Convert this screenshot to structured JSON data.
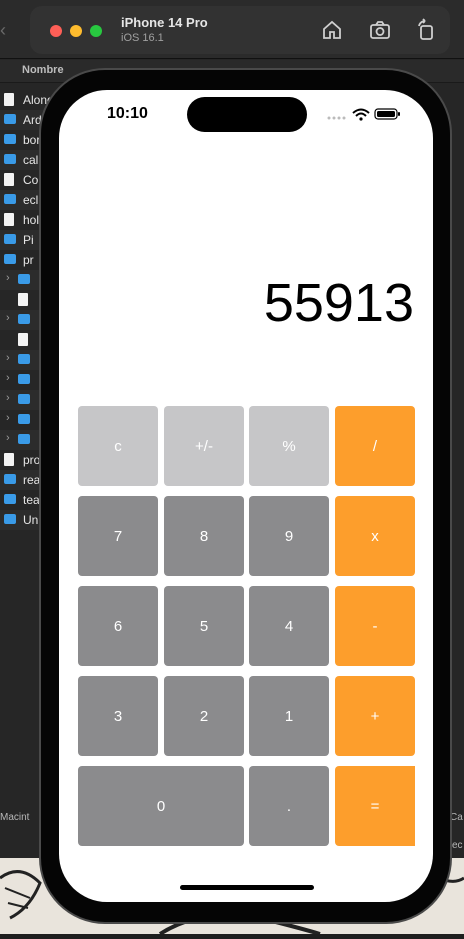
{
  "simulator": {
    "device": "iPhone 14 Pro",
    "os": "iOS 16.1",
    "icons": [
      "home-icon",
      "screenshot-icon",
      "rotate-icon"
    ]
  },
  "finder": {
    "column_header": "Nombre",
    "rows": [
      {
        "label": "Alond",
        "kind": "file"
      },
      {
        "label": "Ard",
        "kind": "folder"
      },
      {
        "label": "bor",
        "kind": "folder"
      },
      {
        "label": "cal",
        "kind": "folder"
      },
      {
        "label": "Co",
        "kind": "file"
      },
      {
        "label": "ecl",
        "kind": "folder"
      },
      {
        "label": "hol",
        "kind": "file"
      },
      {
        "label": "Pi",
        "kind": "folder"
      },
      {
        "label": "pr",
        "kind": "folder"
      },
      {
        "label": "",
        "kind": "folder"
      },
      {
        "label": "",
        "kind": "file"
      },
      {
        "label": "",
        "kind": "folder"
      },
      {
        "label": "",
        "kind": "file"
      },
      {
        "label": "",
        "kind": "folder"
      },
      {
        "label": "",
        "kind": "folder"
      },
      {
        "label": "",
        "kind": "folder"
      },
      {
        "label": "",
        "kind": "folder"
      },
      {
        "label": "",
        "kind": "folder"
      },
      {
        "label": "pro",
        "kind": "file"
      },
      {
        "label": "rea",
        "kind": "folder"
      },
      {
        "label": "tea",
        "kind": "folder"
      },
      {
        "label": "Uni",
        "kind": "folder"
      }
    ],
    "bottom_path": "Macint",
    "right_path": "Ca",
    "right_path2": "ec"
  },
  "phone": {
    "time": "10:10",
    "display_value": "55913",
    "keys": {
      "clear": "c",
      "sign": "+/-",
      "percent": "%",
      "divide": "/",
      "seven": "7",
      "eight": "8",
      "nine": "9",
      "multiply": "x",
      "six": "6",
      "five": "5",
      "four": "4",
      "minus": "-",
      "three": "3",
      "two": "2",
      "one": "1",
      "plus": "+",
      "zero": "0",
      "decimal": ".",
      "equals": "="
    }
  },
  "colors": {
    "operator": "#fd9e2c",
    "number": "#8b8b8d",
    "function": "#c6c6c8"
  }
}
